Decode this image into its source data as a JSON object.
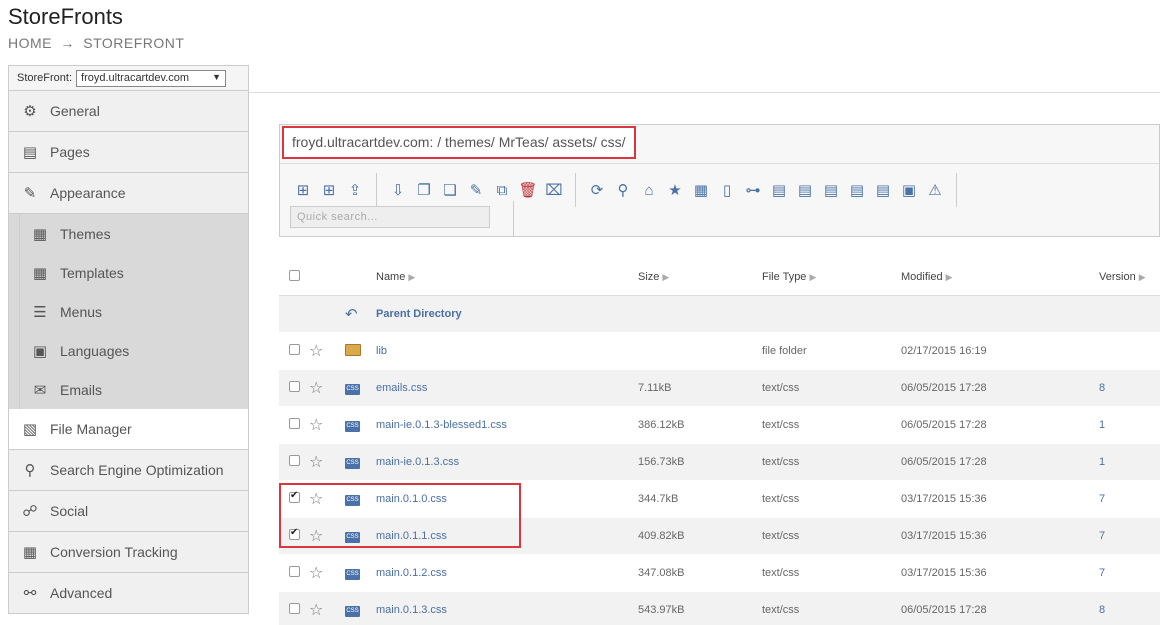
{
  "app": {
    "title": "StoreFronts"
  },
  "breadcrumb": {
    "home": "HOME",
    "separator": "→",
    "current": "STOREFRONT"
  },
  "sidebar": {
    "storefront_label": "StoreFront:",
    "storefront_value": "froyd.ultracartdev.com",
    "items": [
      {
        "label": "General",
        "icon": "gear-icon"
      },
      {
        "label": "Pages",
        "icon": "pages-icon"
      },
      {
        "label": "Appearance",
        "icon": "brush-icon"
      }
    ],
    "sub_items": [
      {
        "label": "Themes",
        "icon": "themes-icon"
      },
      {
        "label": "Templates",
        "icon": "templates-icon"
      },
      {
        "label": "Menus",
        "icon": "menus-icon"
      },
      {
        "label": "Languages",
        "icon": "languages-icon"
      },
      {
        "label": "Emails",
        "icon": "emails-icon"
      }
    ],
    "items_after": [
      {
        "label": "File Manager",
        "icon": "file-manager-icon",
        "active": true
      },
      {
        "label": "Search Engine Optimization",
        "icon": "search-icon"
      },
      {
        "label": "Social",
        "icon": "social-icon"
      },
      {
        "label": "Conversion Tracking",
        "icon": "conversion-icon"
      },
      {
        "label": "Advanced",
        "icon": "advanced-icon"
      }
    ]
  },
  "file_manager": {
    "path": "froyd.ultracartdev.com: /  themes/  MrTeas/  assets/  css/",
    "search_placeholder": "Quick search...",
    "columns": {
      "name": "Name",
      "size": "Size",
      "type": "File Type",
      "modified": "Modified",
      "version": "Version"
    },
    "parent_label": "Parent Directory",
    "rows": [
      {
        "name": "lib",
        "size": "",
        "type": "file folder",
        "modified": "02/17/2015 16:19",
        "version": "",
        "kind": "folder",
        "checked": false
      },
      {
        "name": "emails.css",
        "size": "7.11kB",
        "type": "text/css",
        "modified": "06/05/2015 17:28",
        "version": "8",
        "kind": "css",
        "checked": false
      },
      {
        "name": "main-ie.0.1.3-blessed1.css",
        "size": "386.12kB",
        "type": "text/css",
        "modified": "06/05/2015 17:28",
        "version": "1",
        "kind": "css",
        "checked": false
      },
      {
        "name": "main-ie.0.1.3.css",
        "size": "156.73kB",
        "type": "text/css",
        "modified": "06/05/2015 17:28",
        "version": "1",
        "kind": "css",
        "checked": false
      },
      {
        "name": "main.0.1.0.css",
        "size": "344.7kB",
        "type": "text/css",
        "modified": "03/17/2015 15:36",
        "version": "7",
        "kind": "css",
        "checked": true
      },
      {
        "name": "main.0.1.1.css",
        "size": "409.82kB",
        "type": "text/css",
        "modified": "03/17/2015 15:36",
        "version": "7",
        "kind": "css",
        "checked": true
      },
      {
        "name": "main.0.1.2.css",
        "size": "347.08kB",
        "type": "text/css",
        "modified": "03/17/2015 15:36",
        "version": "7",
        "kind": "css",
        "checked": false
      },
      {
        "name": "main.0.1.3.css",
        "size": "543.97kB",
        "type": "text/css",
        "modified": "06/05/2015 17:28",
        "version": "8",
        "kind": "css",
        "checked": false
      }
    ]
  },
  "colors": {
    "highlight": "#d9363e",
    "link": "#4a6fa5"
  }
}
